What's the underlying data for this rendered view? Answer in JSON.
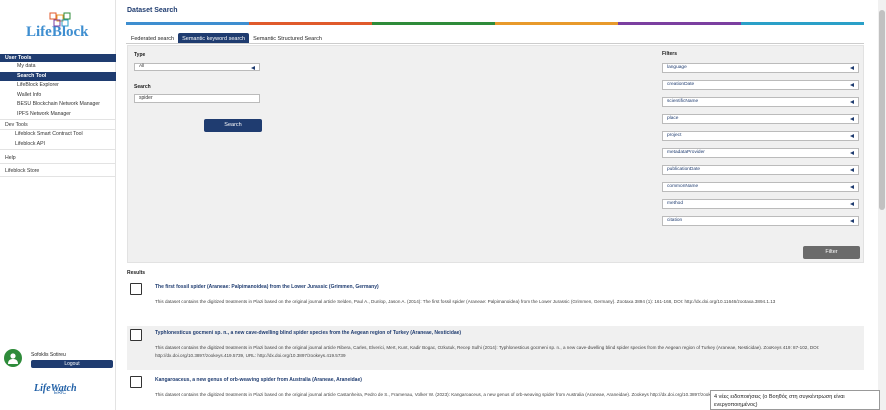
{
  "logo": {
    "text": "LifeBlock"
  },
  "sidebar": {
    "user_tools": "User Tools",
    "user_items": [
      "My data",
      "Search Tool",
      "LifeBlock Explorer",
      "Wallet Info",
      "BESU Blockchain Network Manager",
      "IPFS Network Manager"
    ],
    "dev_tools": "Dev Tools",
    "dev_items": [
      "Lifeblock Smart Contract Tool",
      "Lifeblock API"
    ],
    "help": "Help",
    "store": "Lifeblock Store"
  },
  "user": {
    "name": "Sofoklis Sotireu",
    "logout_label": "Logout"
  },
  "lifewatch_logo": {
    "text": "LifeWatch",
    "sub": "ERIC"
  },
  "page": {
    "title": "Dataset Search"
  },
  "colors": {
    "accent": "#1f3c70",
    "bar": [
      "#3e8ed0",
      "#e05a2b",
      "#2e8b3a",
      "#e89a2b",
      "#7b3fa0",
      "#2aa0c8"
    ]
  },
  "tabs": [
    "Federated search",
    "Semantic keyword search",
    "Semantic Structured Search"
  ],
  "search": {
    "type_label": "Type",
    "type_value": "All",
    "search_label": "Search",
    "search_value": "spider",
    "search_button": "Search"
  },
  "filters": {
    "label": "Filters",
    "items": [
      "language",
      "creationDate",
      "scientificName",
      "place",
      "project",
      "metadataProvider",
      "publicationDate",
      "commonName",
      "method",
      "citation"
    ],
    "button": "Filter"
  },
  "results": {
    "label": "Results",
    "items": [
      {
        "title": "The first fossil spider (Araneae: Palpimanoidea) from the Lower Jurassic (Grimmen, Germany)",
        "desc": "This dataset contains the digitized treatments in Plazi based on the original journal article Selden, Paul A., Dunlop, Jason A. (2014): The first fossil spider (Araneae: Palpimanoidea) from the Lower Jurassic (Grimmen, Germany). Zootaxa 3894 (1): 161-168, DOI: http://dx.doi.org/10.11646/zootaxa.3894.1.13"
      },
      {
        "title": "Typhlonesticus gocmeni sp. n., a new cave-dwelling blind spider species from the Aegean region of Turkey (Araneae, Nesticidae)",
        "desc": "This dataset contains the digitized treatments in Plazi based on the original journal article Ribera, Carles, Elverici, Mert, Kunt, Kadir Bogac, Ozkutuk, Recep Sulhi (2014): Typhlonesticus gocmeni sp. n., a new cave-dwelling blind spider species from the Aegean region of Turkey (Araneae, Nesticidae). ZooKeys 419: 87-102, DOI: http://dx.doi.org/10.3897/zookeys.419.5739, URL: http://dx.doi.org/10.3897/zookeys.419.5739"
      },
      {
        "title": "Kangaroaceus, a new genus of orb-weaving spider from Australia (Araneae, Araneidae)",
        "desc": "This dataset contains the digitized treatments in Plazi based on the original journal article Castanheira, Pedro de S., Framenau, Volker W. (2023): Kangaroaceus, a new genus of orb-weaving spider from Australia (Araneae, Araneidae). Zookeys http://dx.doi.org/10.3897/zookeys.99.101417, URL: http://dx.doi.org/10.3897/zookeys.99.101417"
      }
    ]
  },
  "toast": {
    "text": "4 νέες ειδοποιήσεις (ο Βοηθός στη συγκέντρωση είναι ενεργοποιημένος)"
  }
}
